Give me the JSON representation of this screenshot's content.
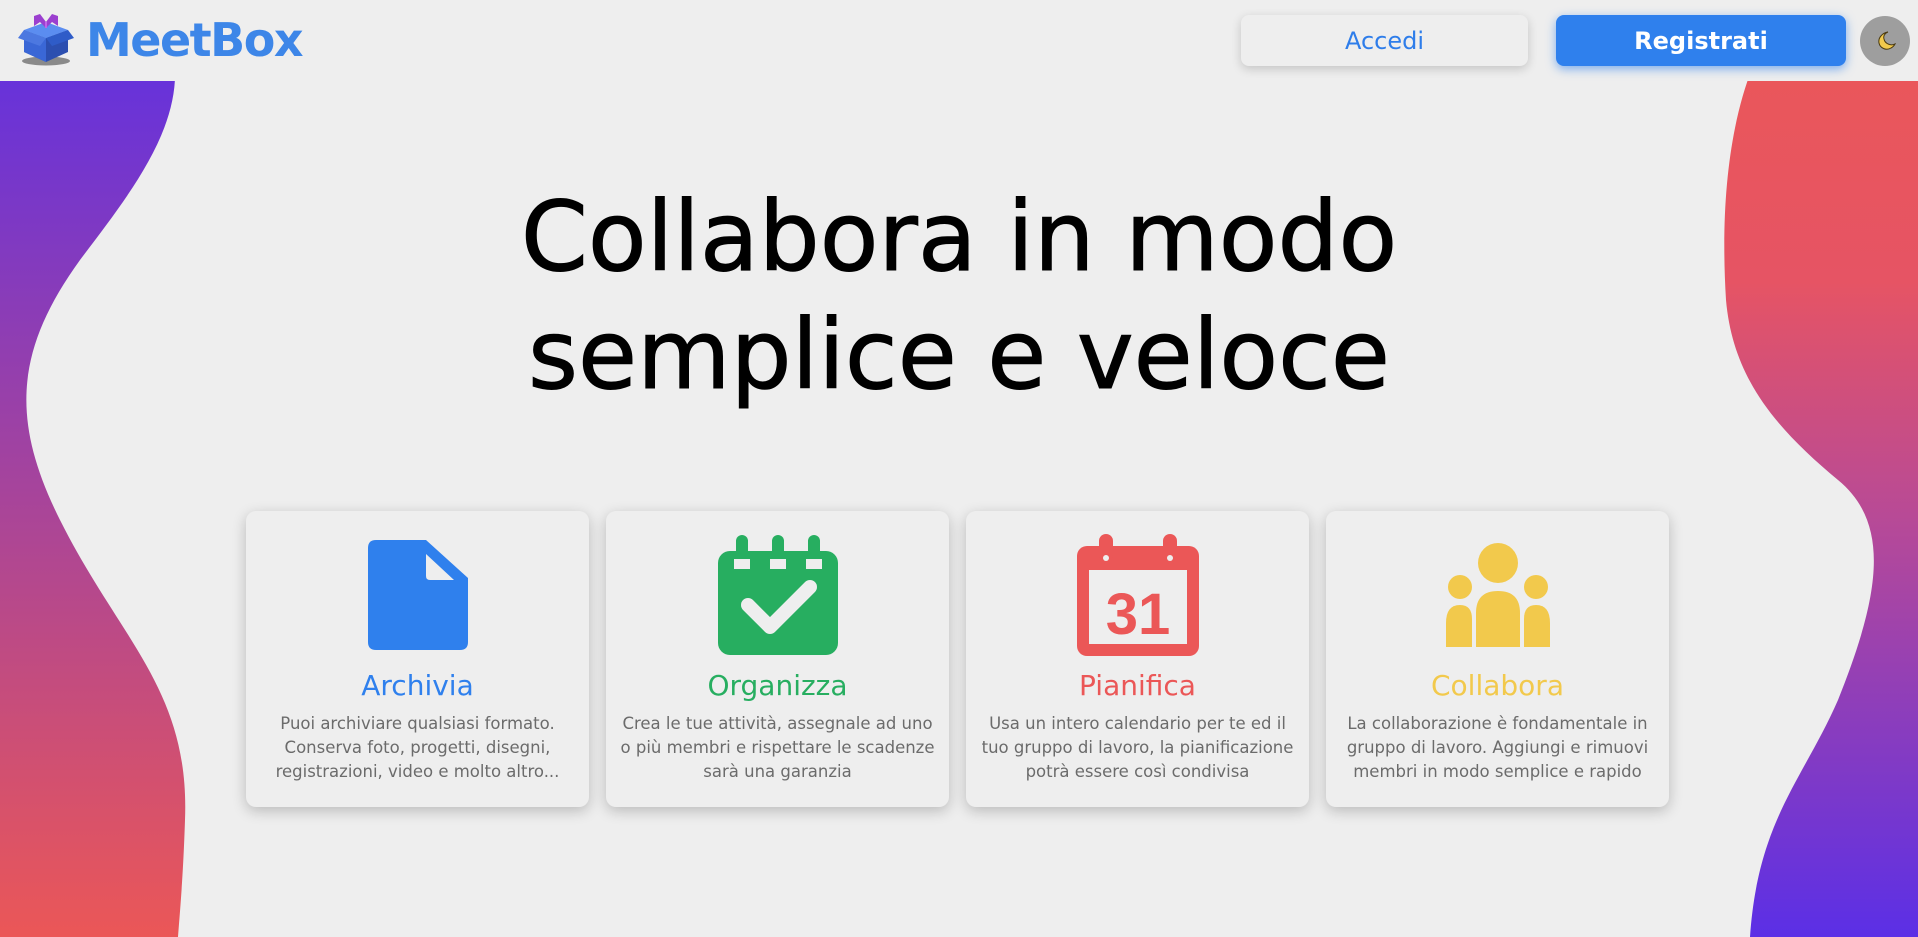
{
  "header": {
    "brand": "MeetBox",
    "login_label": "Accedi",
    "register_label": "Registrati",
    "theme_icon": "moon-icon"
  },
  "hero": {
    "line1": "Collabora in modo",
    "line2": "semplice e veloce"
  },
  "features": [
    {
      "icon": "file-icon",
      "color": "#2f80ed",
      "title": "Archivia",
      "description": "Puoi archiviare qualsiasi formato. Conserva foto, progetti, disegni, registrazioni, video e molto altro..."
    },
    {
      "icon": "calendar-check-icon",
      "color": "#27ae60",
      "title": "Organizza",
      "description": "Crea le tue attività, assegnale ad uno o più membri e rispettare le scadenze sarà una garanzia"
    },
    {
      "icon": "calendar-31-icon",
      "color": "#eb5757",
      "title": "Pianifica",
      "description": "Usa un intero calendario per te ed il tuo gruppo di lavoro, la pianificazione potrà essere così condivisa"
    },
    {
      "icon": "users-icon",
      "color": "#f2c94c",
      "title": "Collabora",
      "description": "La collaborazione è fondamentale in gruppo di lavoro. Aggiungi e rimuovi membri in modo semplice e rapido"
    }
  ],
  "calendar_number": "31",
  "colors": {
    "brand": "#3d86e8",
    "wave_purple": "#5b2fe6",
    "wave_red": "#eb5757",
    "background": "#eeeeee"
  }
}
